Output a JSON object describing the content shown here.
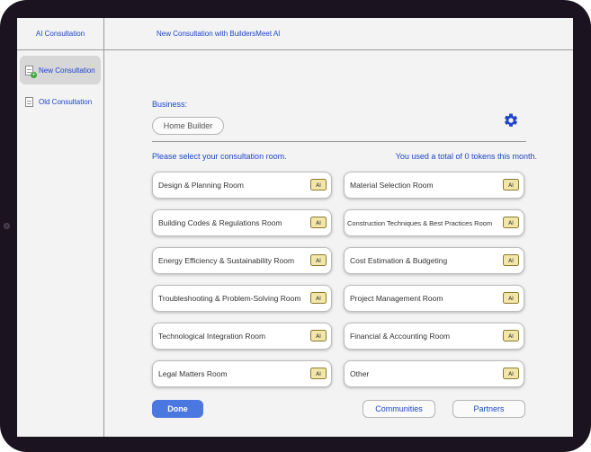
{
  "sidebar": {
    "title": "AI Consultation",
    "items": [
      {
        "label": "New Consultation",
        "active": true
      },
      {
        "label": "Old Consultation",
        "active": false
      }
    ]
  },
  "header": {
    "title": "New Consultation with BuildersMeet AI"
  },
  "business": {
    "label": "Business:",
    "value": "Home Builder"
  },
  "rooms": {
    "prompt": "Please select your consultation room.",
    "tokens_text": "You used a total of 0 tokens this month.",
    "left": [
      "Design & Planning Room",
      "Building Codes & Regulations Room",
      "Energy Efficiency & Sustainability Room",
      "Troubleshooting & Problem-Solving Room",
      "Technological Integration Room",
      "Legal Matters Room"
    ],
    "right": [
      "Material Selection Room",
      "Construction Techniques & Best Practices Room",
      "Cost Estimation & Budgeting",
      "Project Management Room",
      "Financial & Accounting Room",
      "Other"
    ]
  },
  "actions": {
    "done_label": "Done",
    "communities_label": "Communities",
    "partners_label": "Partners"
  },
  "colors": {
    "accent": "#1e46c8",
    "done_button": "#4b78e0",
    "frame": "#1c1320"
  },
  "icons": [
    "new-doc-icon",
    "doc-icon",
    "gear-icon",
    "chat-badge-icon"
  ]
}
